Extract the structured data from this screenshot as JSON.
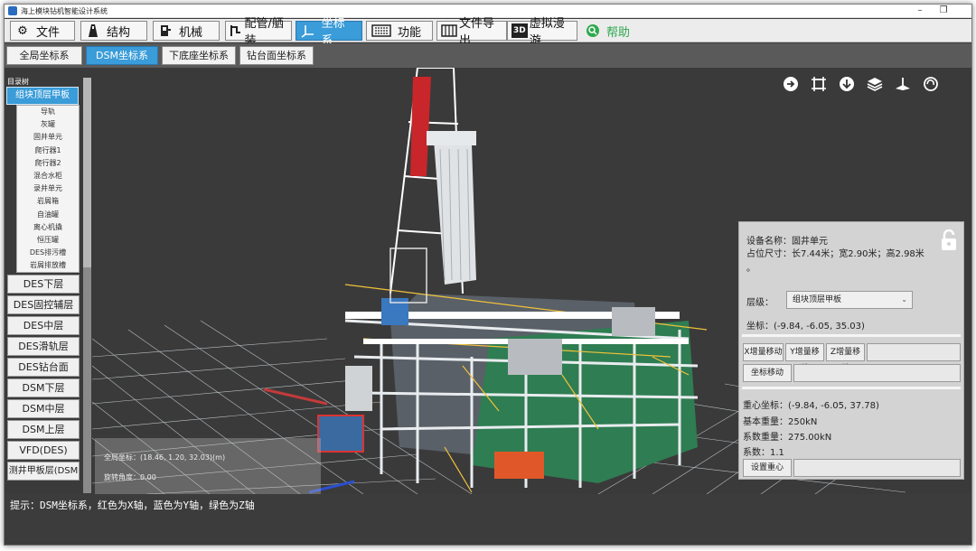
{
  "window": {
    "title": "海上模块钻机智能设计系统"
  },
  "menu": [
    {
      "label": "文件",
      "icon": "gear-icon"
    },
    {
      "label": "结构",
      "icon": "derrick-icon"
    },
    {
      "label": "机械",
      "icon": "pump-icon"
    },
    {
      "label": "配管/舾装",
      "icon": "pipe-icon"
    },
    {
      "label": "坐标系",
      "icon": "axis-icon",
      "active": true
    },
    {
      "label": "功能",
      "icon": "keyboard-icon"
    },
    {
      "label": "文件导出",
      "icon": "book-icon"
    },
    {
      "label": "虚拟漫游",
      "icon": "3d-icon",
      "badge": "3D"
    },
    {
      "label": "帮助",
      "icon": "search-help-icon"
    }
  ],
  "subtabs": [
    "全局坐标系",
    "DSM坐标系",
    "下底座坐标系",
    "钻台面坐标系"
  ],
  "tree": {
    "header": "目录树",
    "group": "组块顶层甲板",
    "items": [
      "导轨",
      "灰罐",
      "固井单元",
      "爬行器1",
      "爬行器2",
      "混合水柜",
      "录井单元",
      "岩屑箱",
      "自油罐",
      "离心机撬",
      "恒压罐",
      "DES排污槽",
      "岩屑排放槽"
    ],
    "groups": [
      "DES下层",
      "DES固控辅层",
      "DES中层",
      "DES滑轨层",
      "DES钻台面",
      "DSM下层",
      "DSM中层",
      "DSM上层",
      "VFD(DES)",
      "测井甲板层(DSM"
    ]
  },
  "info": {
    "device_name": "设备名称：固井单元",
    "size": "占位尺寸：长7.44米；宽2.90米；高2.98米",
    "size_tail": "。",
    "layer_label": "层级：",
    "layer_value": "组块顶层甲板",
    "coord": "坐标：(-9.84, -6.05, 35.03)",
    "btn_x": "X增量移动",
    "btn_y": "Y增量移动",
    "btn_z": "Z增量移动",
    "btn_move": "坐标移动",
    "cog": "重心坐标：(-9.84, -6.05, 37.78)",
    "base_weight": "基本重量：250kN",
    "coef_weight": "系数重量：275.00kN",
    "coef": "系数：1.1",
    "btn_set_cog": "设置重心"
  },
  "coord_overlay": {
    "line1": "全局坐标：(18.46, 1.20, 32.03)(m)",
    "line2": "旋转角度：0.00"
  },
  "status": {
    "hint": "提示：DSM坐标系，红色为X轴，蓝色为Y轴，绿色为Z轴"
  },
  "colors": {
    "accent": "#3a9cd8",
    "help_green": "#2fa84f"
  }
}
